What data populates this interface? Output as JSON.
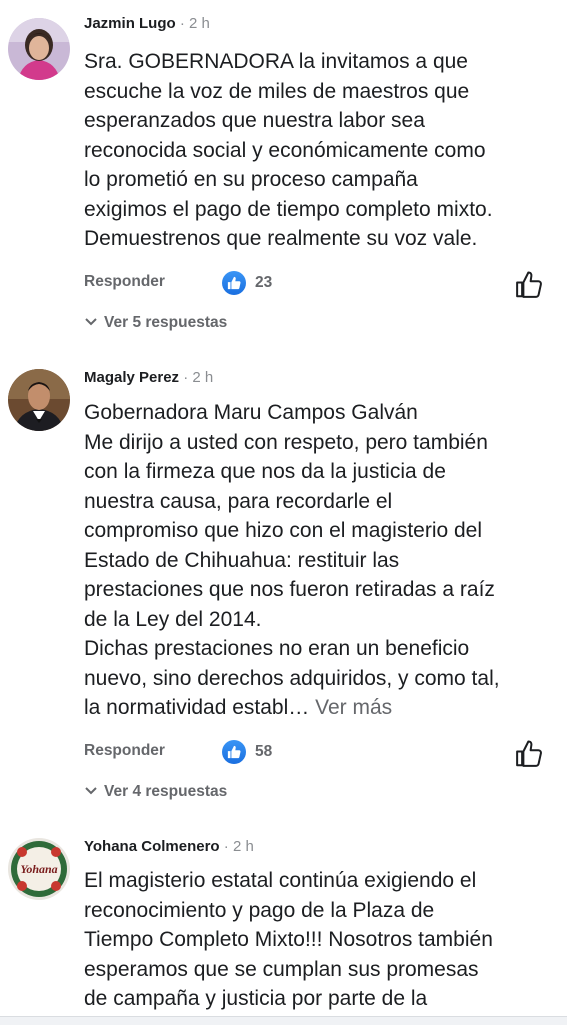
{
  "comments": [
    {
      "author": "Jazmin Lugo",
      "separator": "·",
      "time": "2 h",
      "lines": [
        "Sra. GOBERNADORA la invitamos a que",
        "escuche la voz de miles de maestros que",
        "esperanzados que nuestra labor sea",
        "reconocida social y económicamente como",
        "lo prometió en su proceso campaña",
        "exigimos el pago de tiempo completo mixto.",
        "Demuestrenos que realmente su voz vale."
      ],
      "reply_label": "Responder",
      "likes": "23",
      "replies_label": "Ver 5 respuestas"
    },
    {
      "author": "Magaly Perez",
      "separator": "·",
      "time": "2 h",
      "lines": [
        "Gobernadora Maru Campos Galván",
        "Me dirijo a usted con respeto, pero también",
        "con la firmeza que nos da la justicia de",
        "nuestra causa, para recordarle el",
        "compromiso que hizo con el magisterio del",
        "Estado de Chihuahua: restituir las",
        "prestaciones que nos fueron retiradas a raíz",
        "de la Ley del 2014.",
        "Dichas prestaciones no eran un beneficio",
        "nuevo, sino derechos adquiridos, y como tal,",
        "la normatividad establ…"
      ],
      "see_more": "Ver más",
      "reply_label": "Responder",
      "likes": "58",
      "replies_label": "Ver 4 respuestas"
    },
    {
      "author": "Yohana Colmenero",
      "separator": "·",
      "time": "2 h",
      "avatar_text": "Yohana",
      "lines": [
        "El magisterio estatal continúa exigiendo el",
        "reconocimiento y pago de la Plaza de",
        "Tiempo Completo Mixto!!! Nosotros también",
        "esperamos que se cumplan sus promesas",
        "de campaña y justicia por parte de la"
      ]
    }
  ],
  "icons": {
    "like_badge": "thumbs-up-icon",
    "like_button": "thumbs-up-outline-icon",
    "replies": "chevron-down-icon"
  },
  "colors": {
    "accent": "#1877f2",
    "secondary_text": "#65676b"
  }
}
